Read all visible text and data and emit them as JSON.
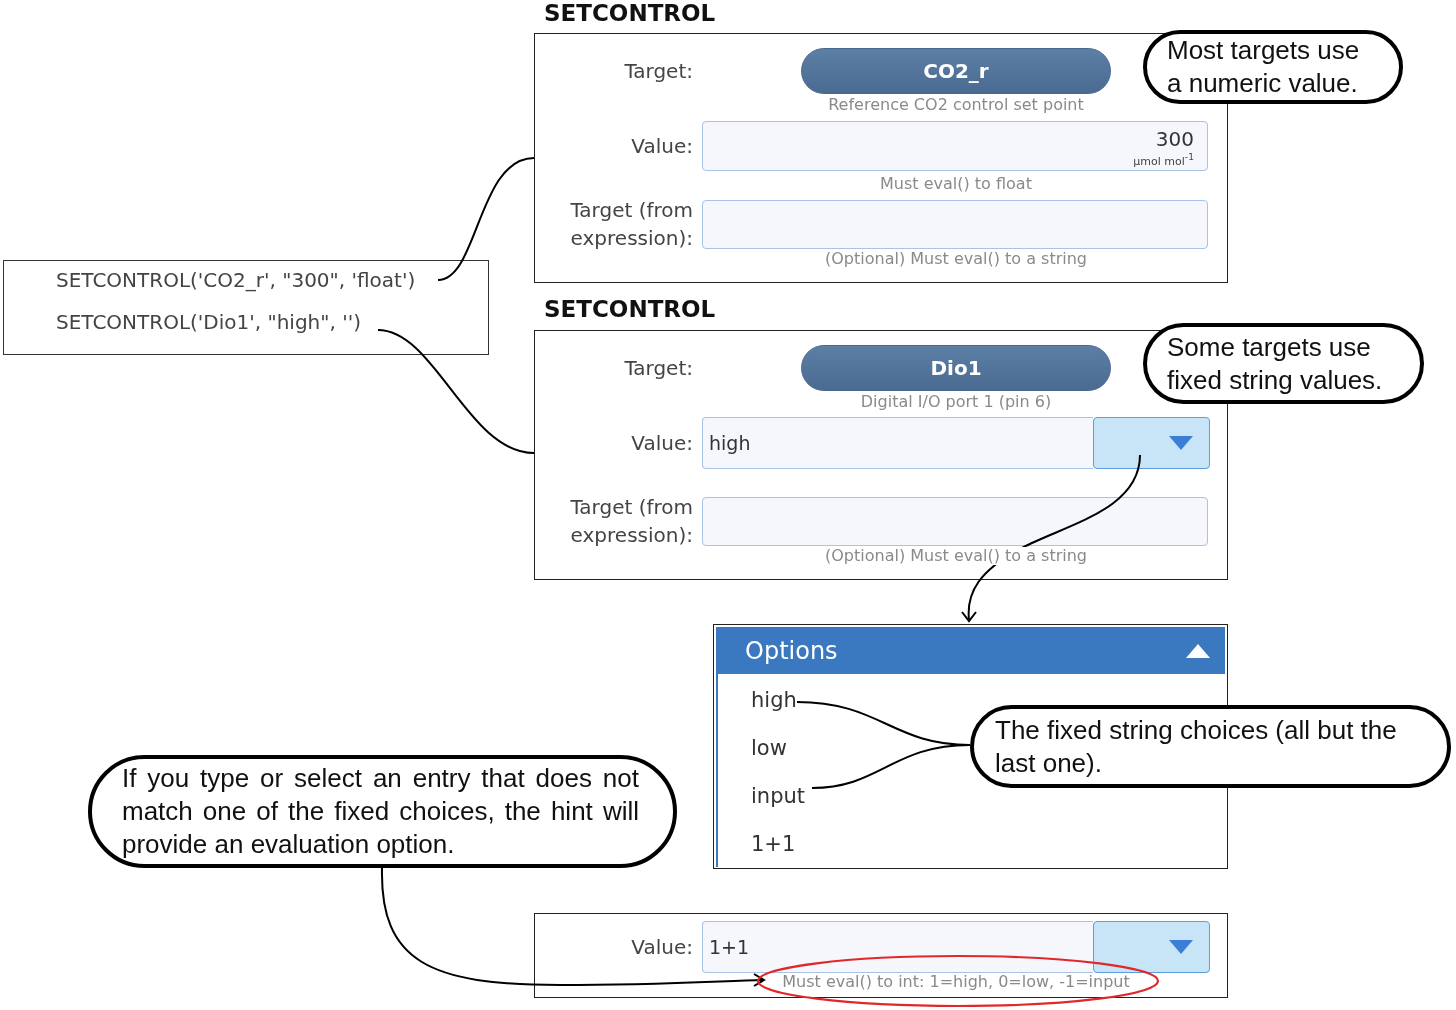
{
  "code_box": {
    "lines": [
      "SETCONTROL('CO2_r', \"300\", 'float')",
      "SETCONTROL('Dio1', \"high\", '')"
    ]
  },
  "panels": [
    {
      "kind": "numeric",
      "title": "SETCONTROL",
      "target_label": "Target:",
      "target": "CO2_r",
      "target_description": "Reference CO2 control set point",
      "value_label": "Value:",
      "value": "300",
      "unit": "µmol mol$^{-1}$",
      "value_hint": "Must eval() to float",
      "expression_label": "Target (from expression):",
      "expression_hint": "(Optional) Must eval() to a string"
    },
    {
      "kind": "choice",
      "title": "SETCONTROL",
      "target_label": "Target:",
      "target": "Dio1",
      "target_description": "Digital I/O port 1 (pin 6)",
      "value_label": "Value:",
      "value": "high",
      "expression_label": "Target (from expression):",
      "expression_hint": "(Optional) Must eval() to a string"
    }
  ],
  "options_list": {
    "title": "Options",
    "items": [
      "high",
      "low",
      "input",
      "1+1"
    ]
  },
  "hint_example": {
    "value_label": "Value:",
    "value": "1+1",
    "hint": "Must eval() to int: 1=high, 0=low, -1=input",
    "highlighted": true
  },
  "callouts": [
    {
      "text": "Most targets use a numeric value."
    },
    {
      "text": "Some targets use fixed string values."
    },
    {
      "text": "The fixed string choices (all but the last one)."
    },
    {
      "text": "If you type or select an entry that does not match one of the fixed choices, the hint will provide an evaluation option."
    }
  ]
}
